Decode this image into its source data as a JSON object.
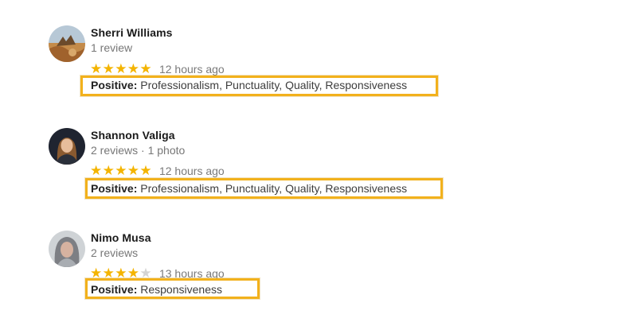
{
  "reviews": [
    {
      "name": "Sherri Williams",
      "meta": "1 review",
      "rating": 5,
      "time": "12 hours ago",
      "positive_label": "Positive:",
      "positive_text": "Professionalism, Punctuality, Quality, Responsiveness"
    },
    {
      "name": "Shannon Valiga",
      "meta": "2 reviews · 1 photo",
      "rating": 5,
      "time": "12 hours ago",
      "positive_label": "Positive:",
      "positive_text": "Professionalism, Punctuality, Quality, Responsiveness"
    },
    {
      "name": "Nimo Musa",
      "meta": "2 reviews",
      "rating": 4,
      "time": "13 hours ago",
      "positive_label": "Positive:",
      "positive_text": "Responsiveness"
    }
  ],
  "colors": {
    "star_filled": "#f4b400",
    "star_empty": "#d4d4d4",
    "highlight_border": "#f2b11c"
  },
  "icons": {
    "avatar": "profile-photo",
    "star": "star-icon"
  }
}
